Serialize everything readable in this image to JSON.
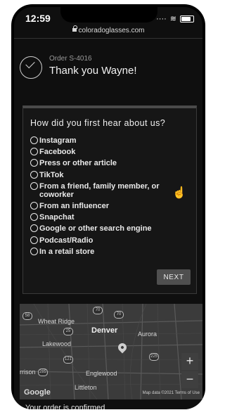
{
  "status_bar": {
    "time": "12:59",
    "url": "coloradoglasses.com"
  },
  "order": {
    "number": "Order S-4016",
    "thanks": "Thank you Wayne!"
  },
  "survey": {
    "question": "How did you first hear about us?",
    "options": [
      "Instagram",
      "Facebook",
      "Press or other article",
      "TikTok",
      "From a friend, family member, or coworker",
      "From an influencer",
      "Snapchat",
      "Google or other search engine",
      "Podcast/Radio",
      "In a retail store"
    ],
    "next_label": "NEXT"
  },
  "map": {
    "labels": {
      "wheat_ridge": "Wheat Ridge",
      "denver": "Denver",
      "aurora": "Aurora",
      "lakewood": "Lakewood",
      "englewood": "Englewood",
      "littleton": "Littleton",
      "morrison": "rrison"
    },
    "shields": [
      "70",
      "70",
      "76",
      "121",
      "285",
      "225",
      "25",
      "58"
    ],
    "zoom_in": "+",
    "zoom_out": "−",
    "google": "Google",
    "attribution": "Map data ©2021   Terms of Use"
  },
  "confirmation_text": "Your order is confirmed"
}
